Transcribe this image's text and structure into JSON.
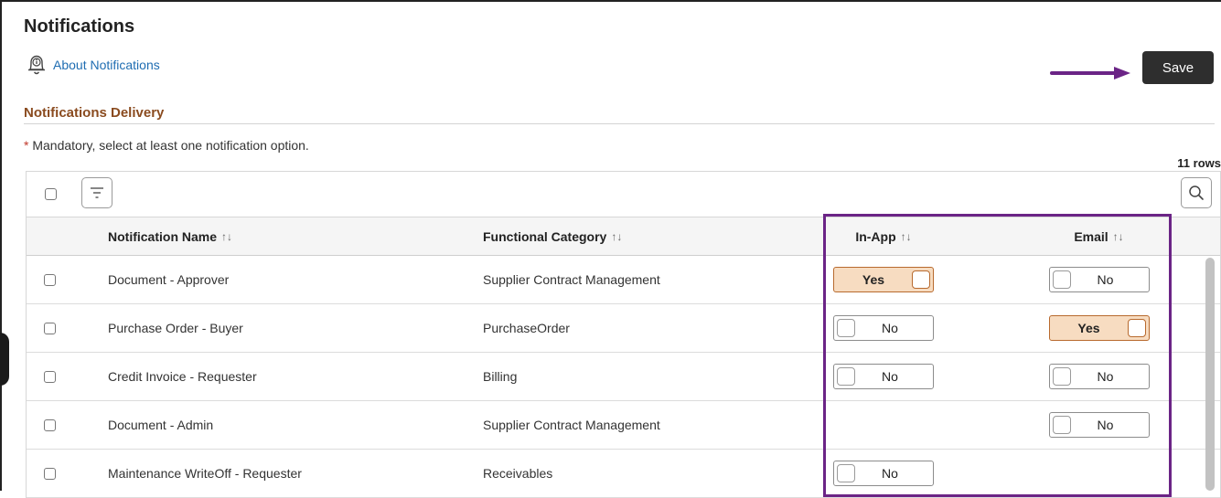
{
  "page": {
    "title": "Notifications",
    "about_link": "About Notifications",
    "save_label": "Save"
  },
  "section": {
    "title": "Notifications Delivery",
    "mandatory_star": "*",
    "mandatory_text": " Mandatory, select at least one notification option.",
    "row_count": "11 rows"
  },
  "columns": {
    "name": "Notification Name",
    "category": "Functional Category",
    "inapp": "In-App",
    "email": "Email",
    "sort_glyph": "↑↓"
  },
  "rows": [
    {
      "name": "Document - Approver",
      "category": "Supplier Contract Management",
      "inapp": "Yes",
      "email": "No"
    },
    {
      "name": "Purchase Order - Buyer",
      "category": "PurchaseOrder",
      "inapp": "No",
      "email": "Yes"
    },
    {
      "name": "Credit Invoice - Requester",
      "category": "Billing",
      "inapp": "No",
      "email": "No"
    },
    {
      "name": "Document - Admin",
      "category": "Supplier Contract Management",
      "inapp": "",
      "email": "No"
    },
    {
      "name": "Maintenance WriteOff - Requester",
      "category": "Receivables",
      "inapp": "No",
      "email": ""
    }
  ],
  "colors": {
    "accent_section": "#8a4b1f",
    "link": "#1f6db2",
    "annotation": "#6b2486",
    "toggle_on_bg": "#f7dcc1",
    "toggle_on_border": "#b86a2e",
    "save_bg": "#2e2e2e"
  },
  "icons": {
    "about": "bell-info-icon",
    "filter": "filter-icon",
    "search": "search-icon",
    "annotation_arrow": "arrow-right-icon"
  }
}
